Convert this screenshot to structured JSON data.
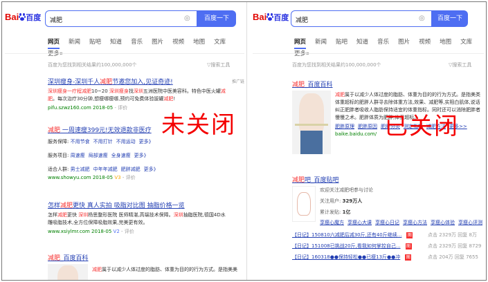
{
  "left": {
    "logo": {
      "brand_text": "Bai",
      "brand_cn": "百度"
    },
    "search": {
      "query": "减肥",
      "button_label": "百度一下"
    },
    "tabs": [
      "网页",
      "新闻",
      "贴吧",
      "知道",
      "音乐",
      "图片",
      "视频",
      "地图",
      "文库",
      "更多»"
    ],
    "result_count": "百度为您找到相关结果约100,000,000个",
    "tools_label": "▽搜索工具",
    "overlay_text": "未关闭",
    "results": [
      {
        "title_pre": "深圳瘦身-深圳千人",
        "title_em": "减肥",
        "title_post": "节邀您加入,见证奇迹!",
        "ad_label": "推广链接",
        "desc_1": "深圳瘦身一疗程",
        "desc_em1": "减肥",
        "desc_2": "10~20 ",
        "desc_em2": "深圳瘦身",
        "desc_3": "找",
        "desc_em3": "深圳",
        "desc_4": "五洲医院中医美容科。特色中医火罐",
        "desc_em4": "减肥",
        "desc_5": "。每次治疗30分钟,想瘦哪瘦哪,预约可免费体验拔罐",
        "desc_em5": "减肥",
        "desc_6": "!",
        "url": "pifu.szwz160.com",
        "date": "2018-05",
        "rating": "评价"
      },
      {
        "title_pre": "",
        "title_em": "减肥",
        "title_post": " 一周速瘦399元!无效退款非医疗",
        "svc_label_1": "服务保障:",
        "svc_items_1": [
          "不用节食",
          "不用打针",
          "不用运动",
          "更多》"
        ],
        "svc_label_2": "服务项目:",
        "svc_items_2": [
          "周速瘦",
          "局部速瘦",
          "全身速瘦",
          "更多》"
        ],
        "svc_label_3": "适合人群:",
        "svc_items_3": [
          "男士减肥",
          "中年年减肥",
          "肥胖减肥",
          "更多》"
        ],
        "url": "www.showyu.com",
        "date": "2018-05",
        "v_badge": "V3",
        "rating": "评价"
      },
      {
        "title_pre": "怎样",
        "title_em": "减肥",
        "title_post": "更快 真人实拍 吸脂对比图 抽脂价格一览",
        "desc_1": "怎样",
        "desc_em1": "减肥",
        "desc_2": "更快 ",
        "desc_em2": "深圳",
        "desc_3": "杨思整形医院 医师精湛,高端技术保障。",
        "desc_em3": "深圳",
        "desc_4": "抽脂医院,德国4D水雕吸脂技术,全方位保障吸脂效果,完美更有效。",
        "url": "www.xsiylmr.com",
        "date": "2018-05",
        "v_badge": "V2",
        "rating": "评价"
      },
      {
        "title_em": "减肥",
        "title_post": "_百度百科",
        "desc_em1": "减肥",
        "desc_2": "属于以减少人体过度的脂肪、体重为目的的行为方式。是指美美"
      }
    ]
  },
  "right": {
    "logo": {
      "brand_text": "Bai",
      "brand_cn": "百度"
    },
    "search": {
      "query": "减肥",
      "button_label": "百度一下"
    },
    "tabs": [
      "网页",
      "新闻",
      "贴吧",
      "知道",
      "音乐",
      "图片",
      "视频",
      "地图",
      "文库",
      "更多»"
    ],
    "result_count": "百度为您找到相关结果约100,000,000个",
    "tools_label": "▽搜索工具",
    "overlay_text": "已关闭",
    "baike": {
      "title_em": "减肥",
      "title_post": "_百度百科",
      "desc_em": "减肥",
      "desc": "属于以减少人体过度的脂肪、体重为目的的行为方式。是指美类体重超标的肥胖人群寻去除体重方法,效果、减肥等,实阻白肌体,说话纠正肥胖者吸收人脂肪保持适宜的体重指标。同时还可以消除肥胖者慢慢之术。肥胖体质为肥胖,体重超标。",
      "links": [
        "肥胖原理",
        "肥胖原因",
        "肥胖分类",
        "测定指标",
        "减肥方法",
        "更多>>"
      ],
      "url": "baike.baidu.com/"
    },
    "tieba": {
      "title_em": "减肥",
      "title_post": "吧_百度贴吧",
      "welcome": "欢迎关注减肥吧参与讨论",
      "follow_label": "关注用户:",
      "follow_value": "329万人",
      "posts_label": "累计发贴:",
      "posts_value": "1亿",
      "links": [
        "享瘦心魔方",
        "享瘦心大课",
        "享瘦心日记",
        "享瘦心方法",
        "享瘦心体验",
        "享瘦心评测"
      ],
      "threads": [
        {
          "tag": "【日记】",
          "title": "150810六减肥后减30斤,还有40斤继续...",
          "badge": "图",
          "click_label": "点击",
          "click_value": "2329万",
          "reply_label": "回复",
          "reply_value": "8万"
        },
        {
          "tag": "【日记】",
          "title": "151008已挑战20斤,看我如何掌控自己...",
          "badge": "图",
          "click_label": "点击",
          "click_value": "2329万",
          "reply_label": "回复",
          "reply_value": "8729"
        },
        {
          "tag": "【日记】",
          "title": "160318●●保持轻松●●已瘦13斤●●冲",
          "badge": "图",
          "click_label": "点击",
          "click_value": "204万",
          "reply_label": "回复",
          "reply_value": "7655"
        }
      ]
    }
  },
  "colors": {
    "accent": "#4e6ef2",
    "link": "#2440b3",
    "highlight": "#f73131",
    "url_green": "#008000",
    "overlay_red": "#f40000"
  }
}
